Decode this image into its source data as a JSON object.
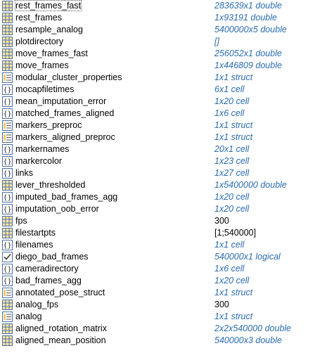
{
  "variables": [
    {
      "name": "rest_frames_fast",
      "value": "283639x1 double",
      "icon": "matrix-icon",
      "style": "summary",
      "selected": true
    },
    {
      "name": "rest_frames",
      "value": "1x93191 double",
      "icon": "matrix-icon",
      "style": "summary"
    },
    {
      "name": "resample_analog",
      "value": "5400000x5 double",
      "icon": "matrix-icon",
      "style": "summary"
    },
    {
      "name": "plotdirectory",
      "value": "[]",
      "icon": "matrix-icon",
      "style": "summary"
    },
    {
      "name": "move_frames_fast",
      "value": "256052x1 double",
      "icon": "matrix-icon",
      "style": "summary"
    },
    {
      "name": "move_frames",
      "value": "1x446809 double",
      "icon": "matrix-icon",
      "style": "summary"
    },
    {
      "name": "modular_cluster_properties",
      "value": "1x1 struct",
      "icon": "struct-icon",
      "style": "summary"
    },
    {
      "name": "mocapfiletimes",
      "value": "6x1 cell",
      "icon": "cell-icon",
      "style": "summary"
    },
    {
      "name": "mean_imputation_error",
      "value": "1x20 cell",
      "icon": "cell-icon",
      "style": "summary"
    },
    {
      "name": "matched_frames_aligned",
      "value": "1x6 cell",
      "icon": "cell-icon",
      "style": "summary"
    },
    {
      "name": "markers_preproc",
      "value": "1x1 struct",
      "icon": "struct-icon",
      "style": "summary"
    },
    {
      "name": "markers_aligned_preproc",
      "value": "1x1 struct",
      "icon": "struct-icon",
      "style": "summary"
    },
    {
      "name": "markernames",
      "value": "20x1 cell",
      "icon": "cell-icon",
      "style": "summary"
    },
    {
      "name": "markercolor",
      "value": "1x23 cell",
      "icon": "cell-icon",
      "style": "summary"
    },
    {
      "name": "links",
      "value": "1x27 cell",
      "icon": "cell-icon",
      "style": "summary"
    },
    {
      "name": "lever_thresholded",
      "value": "1x5400000 double",
      "icon": "matrix-icon",
      "style": "summary"
    },
    {
      "name": "imputed_bad_frames_agg",
      "value": "1x20 cell",
      "icon": "cell-icon",
      "style": "summary"
    },
    {
      "name": "imputation_oob_error",
      "value": "1x20 cell",
      "icon": "cell-icon",
      "style": "summary"
    },
    {
      "name": "fps",
      "value": "300",
      "icon": "matrix-icon",
      "style": "plain"
    },
    {
      "name": "filestartpts",
      "value": "[1;540000]",
      "icon": "matrix-icon",
      "style": "plain"
    },
    {
      "name": "filenames",
      "value": "1x1 cell",
      "icon": "cell-icon",
      "style": "summary"
    },
    {
      "name": "diego_bad_frames",
      "value": "540000x1 logical",
      "icon": "logical-icon",
      "style": "summary"
    },
    {
      "name": "cameradirectory",
      "value": "1x6 cell",
      "icon": "cell-icon",
      "style": "summary"
    },
    {
      "name": "bad_frames_agg",
      "value": "1x20 cell",
      "icon": "cell-icon",
      "style": "summary"
    },
    {
      "name": "annotated_pose_struct",
      "value": "1x1 struct",
      "icon": "struct-icon",
      "style": "summary"
    },
    {
      "name": "analog_fps",
      "value": "300",
      "icon": "matrix-icon",
      "style": "plain"
    },
    {
      "name": "analog",
      "value": "1x1 struct",
      "icon": "struct-icon",
      "style": "summary"
    },
    {
      "name": "aligned_rotation_matrix",
      "value": "2x2x540000 double",
      "icon": "matrix-icon",
      "style": "summary"
    },
    {
      "name": "aligned_mean_position",
      "value": "540000x3 double",
      "icon": "matrix-icon",
      "style": "summary"
    }
  ],
  "colors": {
    "summary_text": "#2b6cb0",
    "icon_border": "#5b7fb0",
    "icon_fill": "#ffe7a3"
  }
}
